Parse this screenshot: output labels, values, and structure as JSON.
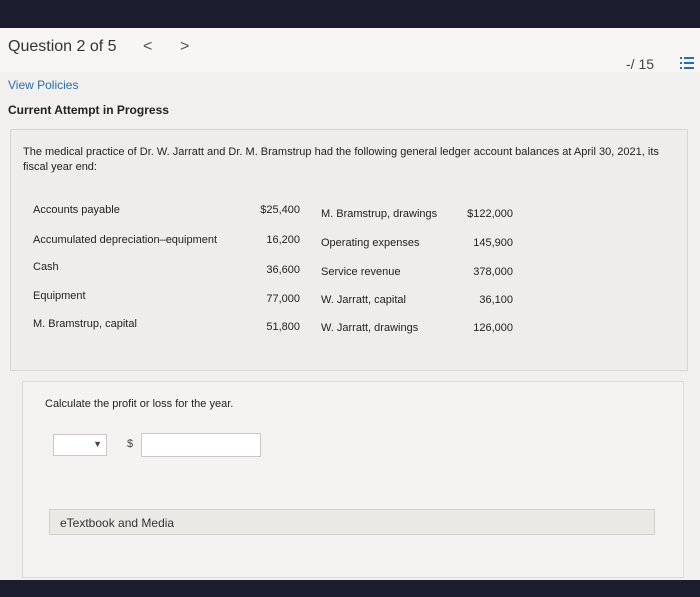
{
  "header": {
    "question_label": "Question 2 of 5",
    "prev": "<",
    "next": ">",
    "score": "-/ 15"
  },
  "links": {
    "view_policies": "View Policies",
    "current_attempt": "Current Attempt in Progress"
  },
  "question": {
    "text": "The medical practice of Dr. W. Jarratt and Dr. M. Bramstrup had the following general ledger account balances at April 30, 2021, its fiscal year end:",
    "accounts_left": [
      {
        "name": "Accounts payable",
        "amount": "$25,400"
      },
      {
        "name": "Accumulated depreciation–equipment",
        "amount": "16,200"
      },
      {
        "name": "Cash",
        "amount": "36,600"
      },
      {
        "name": "Equipment",
        "amount": "77,000"
      },
      {
        "name": "M. Bramstrup, capital",
        "amount": "51,800"
      }
    ],
    "accounts_right": [
      {
        "name": "M. Bramstrup, drawings",
        "amount": "$122,000"
      },
      {
        "name": "Operating expenses",
        "amount": "145,900"
      },
      {
        "name": "Service revenue",
        "amount": "378,000"
      },
      {
        "name": "W. Jarratt, capital",
        "amount": "36,100"
      },
      {
        "name": "W. Jarratt, drawings",
        "amount": "126,000"
      }
    ]
  },
  "answer": {
    "prompt": "Calculate the profit or loss for the year.",
    "currency": "$",
    "select_value": "",
    "amount_value": ""
  },
  "etextbook": {
    "label": "eTextbook and Media"
  },
  "icons": {
    "list": "list-icon",
    "dropdown": "chevron-down-icon"
  }
}
